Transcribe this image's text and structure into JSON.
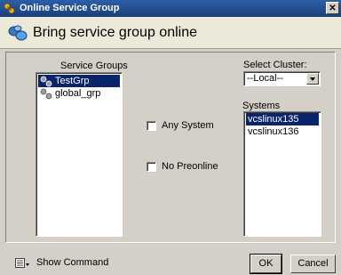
{
  "window": {
    "title": "Online Service Group"
  },
  "header": {
    "title": "Bring service group online"
  },
  "service_groups": {
    "label": "Service Groups",
    "items": [
      {
        "label": "TestGrp",
        "selected": true
      },
      {
        "label": "global_grp",
        "selected": false
      }
    ]
  },
  "options": {
    "any_system": "Any System",
    "no_preonline": "No Preonline"
  },
  "cluster": {
    "label": "Select Cluster:",
    "value": "--Local--"
  },
  "systems": {
    "label": "Systems",
    "items": [
      {
        "label": "vcslinux135",
        "selected": true
      },
      {
        "label": "vcslinux136",
        "selected": false
      }
    ]
  },
  "footer": {
    "show_command": "Show Command",
    "ok": "OK",
    "cancel": "Cancel"
  }
}
